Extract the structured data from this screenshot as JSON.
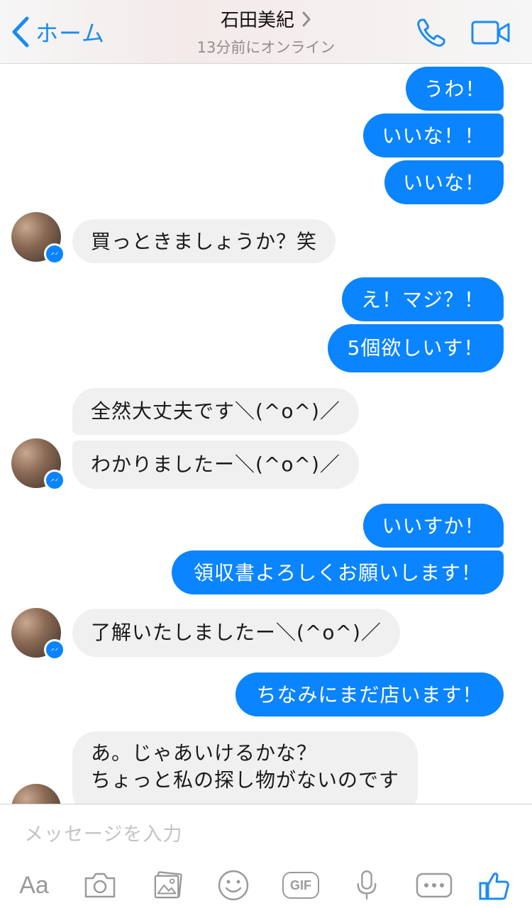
{
  "header": {
    "back_label": "ホーム",
    "title": "石田美紀",
    "status": "13分前にオンライン"
  },
  "messages": [
    {
      "dir": "out",
      "text": "うわ！"
    },
    {
      "dir": "out",
      "text": "いいな！！"
    },
    {
      "dir": "out",
      "text": "いいな！"
    },
    {
      "dir": "in",
      "text": "買っときましょうか？笑"
    },
    {
      "dir": "out",
      "text": "え！マジ？！"
    },
    {
      "dir": "out",
      "text": "5個欲しいす！"
    },
    {
      "dir": "in",
      "text": "全然大丈夫です＼(^o^)／"
    },
    {
      "dir": "in",
      "text": "わかりましたー＼(^o^)／"
    },
    {
      "dir": "out",
      "text": "いいすか！"
    },
    {
      "dir": "out",
      "text": "領収書よろしくお願いします！"
    },
    {
      "dir": "in",
      "text": "了解いたしましたー＼(^o^)／"
    },
    {
      "dir": "out",
      "text": "ちなみにまだ店います！"
    },
    {
      "dir": "in",
      "text": "あ。じゃあいけるかな？"
    },
    {
      "dir": "in",
      "text": "ちょっと私の探し物がないのです"
    }
  ],
  "composer": {
    "placeholder": "メッセージを入力",
    "aa_label": "Aa",
    "gif_label": "GIF"
  },
  "icons": {
    "back": "chevron-left-icon",
    "call": "phone-icon",
    "video": "video-camera-icon",
    "badge": "messenger-icon",
    "camera": "camera-icon",
    "gallery": "photo-gallery-icon",
    "emoji": "smiley-icon",
    "mic": "microphone-icon",
    "more": "more-icon",
    "like": "thumbs-up-icon"
  },
  "colors": {
    "accent": "#0b84ff",
    "incoming_bubble": "#f0f0f0",
    "link": "#1a8cf0"
  }
}
